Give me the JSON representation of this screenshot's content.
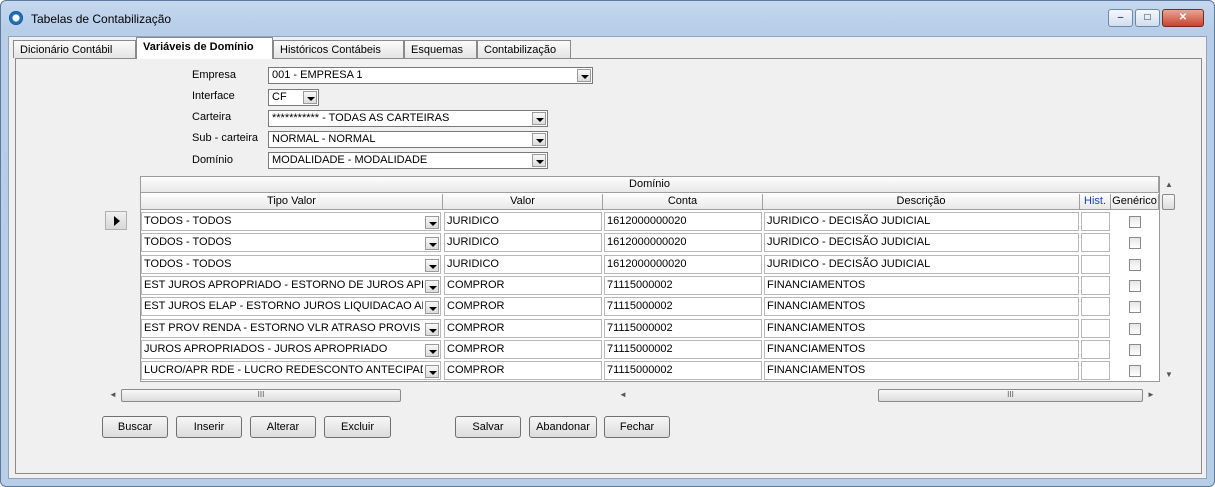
{
  "window": {
    "title": "Tabelas de Contabilização",
    "buttons": {
      "minimize": "–",
      "maximize": "□",
      "close": "✕"
    }
  },
  "tabs": [
    {
      "label": "Dicionário Contábil",
      "active": false
    },
    {
      "label": "Variáveis de Domínio",
      "active": true
    },
    {
      "label": "Históricos Contábeis",
      "active": false
    },
    {
      "label": "Esquemas",
      "active": false
    },
    {
      "label": "Contabilização",
      "active": false
    }
  ],
  "form": {
    "empresa": {
      "label": "Empresa",
      "value": "001 - EMPRESA 1"
    },
    "interface": {
      "label": "Interface",
      "value": "CF"
    },
    "carteira": {
      "label": "Carteira",
      "value": "*********** - TODAS AS CARTEIRAS"
    },
    "subcarteira": {
      "label": "Sub - carteira",
      "value": "NORMAL - NORMAL"
    },
    "dominio": {
      "label": "Domínio",
      "value": "MODALIDADE - MODALIDADE"
    }
  },
  "grid": {
    "group_header": "Domínio",
    "columns": {
      "tipo_valor": "Tipo Valor",
      "valor": "Valor",
      "conta": "Conta",
      "descricao": "Descrição",
      "hist": "Hist.",
      "generico": "Genérico"
    },
    "rows": [
      {
        "tipo": "TODOS - TODOS",
        "valor": "JURIDICO",
        "conta": "1612000000020",
        "descricao": "JURIDICO - DECISÃO JUDICIAL",
        "generico": false
      },
      {
        "tipo": "TODOS - TODOS",
        "valor": "JURIDICO",
        "conta": "1612000000020",
        "descricao": "JURIDICO - DECISÃO JUDICIAL",
        "generico": false
      },
      {
        "tipo": "TODOS - TODOS",
        "valor": "JURIDICO",
        "conta": "1612000000020",
        "descricao": "JURIDICO - DECISÃO JUDICIAL",
        "generico": false
      },
      {
        "tipo": "EST JUROS APROPRIADO - ESTORNO DE JUROS APR",
        "valor": "COMPROR",
        "conta": "71115000002",
        "descricao": "FINANCIAMENTOS",
        "generico": false
      },
      {
        "tipo": "EST JUROS ELAP - ESTORNO JUROS LIQUIDACAO AN",
        "valor": "COMPROR",
        "conta": "71115000002",
        "descricao": "FINANCIAMENTOS",
        "generico": false
      },
      {
        "tipo": "EST PROV RENDA - ESTORNO VLR ATRASO PROVIS",
        "valor": "COMPROR",
        "conta": "71115000002",
        "descricao": "FINANCIAMENTOS",
        "generico": false
      },
      {
        "tipo": "JUROS APROPRIADOS - JUROS APROPRIADO",
        "valor": "COMPROR",
        "conta": "71115000002",
        "descricao": "FINANCIAMENTOS",
        "generico": false
      },
      {
        "tipo": "LUCRO/APR RDE - LUCRO REDESCONTO ANTECIPAD",
        "valor": "COMPROR",
        "conta": "71115000002",
        "descricao": "FINANCIAMENTOS",
        "generico": false
      }
    ],
    "scroll_grip": "III"
  },
  "buttons": {
    "buscar": "Buscar",
    "inserir": "Inserir",
    "alterar": "Alterar",
    "excluir": "Excluir",
    "salvar": "Salvar",
    "abandonar": "Abandonar",
    "fechar": "Fechar"
  },
  "colors": {
    "hist_header": "#1a3fd0",
    "window_frame": "#b8cde6"
  }
}
